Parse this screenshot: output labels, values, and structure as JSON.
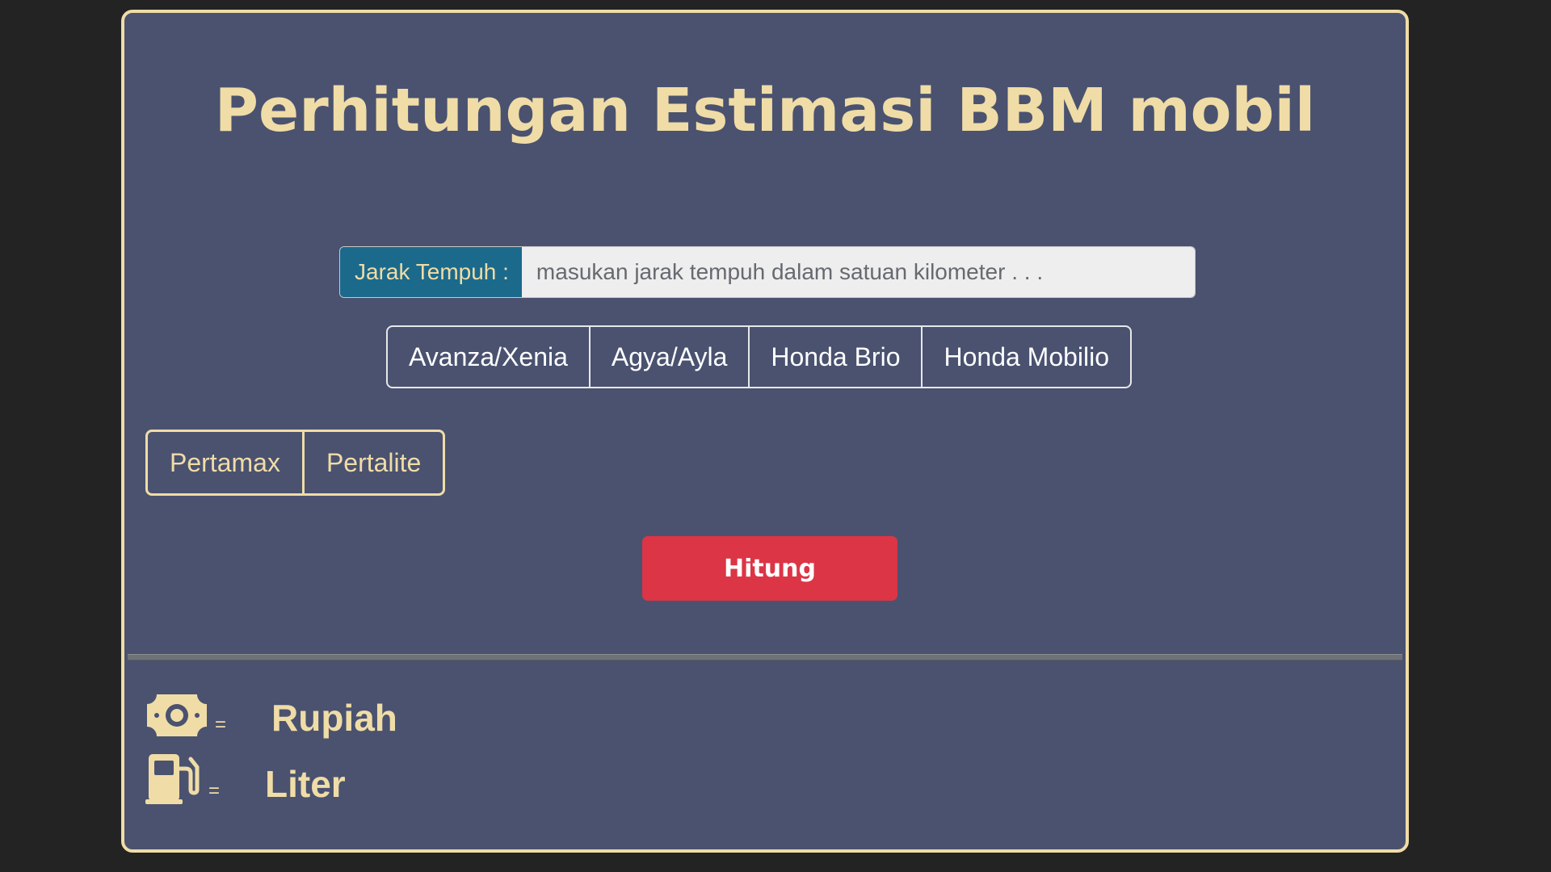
{
  "header": {
    "title": "Perhitungan Estimasi BBM mobil"
  },
  "distance_input": {
    "label": "Jarak Tempuh :",
    "value": "",
    "placeholder": "masukan jarak tempuh dalam satuan kilometer . . ."
  },
  "car_options": [
    {
      "label": "Avanza/Xenia"
    },
    {
      "label": "Agya/Ayla"
    },
    {
      "label": "Honda Brio"
    },
    {
      "label": "Honda Mobilio"
    }
  ],
  "fuel_options": [
    {
      "label": "Pertamax"
    },
    {
      "label": "Pertalite"
    }
  ],
  "calculate_button": {
    "label": "Hitung"
  },
  "results": {
    "cost": {
      "icon": "money-bill-icon",
      "equals": "=",
      "value": "",
      "unit": "Rupiah"
    },
    "fuel": {
      "icon": "gas-pump-icon",
      "equals": "=",
      "value": "",
      "unit": "Liter"
    }
  },
  "colors": {
    "page_background": "#232323",
    "card_background": "#4a5270",
    "accent_cream": "#f0dca6",
    "input_label_bg": "#1b6a8c",
    "button_red": "#dc3545"
  }
}
